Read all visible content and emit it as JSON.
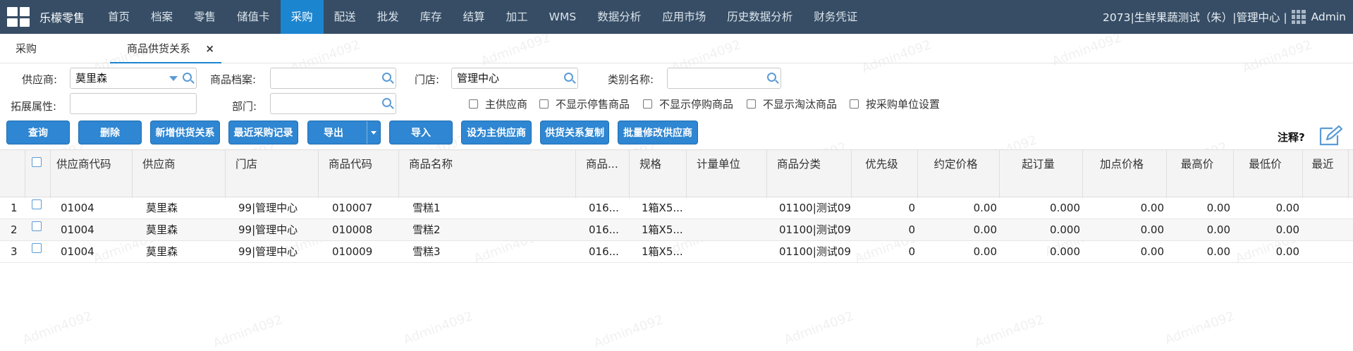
{
  "nav": {
    "brand": "乐檬零售",
    "items": [
      "首页",
      "档案",
      "零售",
      "储值卡",
      "采购",
      "配送",
      "批发",
      "库存",
      "结算",
      "加工",
      "WMS",
      "数据分析",
      "应用市场",
      "历史数据分析",
      "财务凭证"
    ],
    "active_index": 4,
    "org": "2073|生鲜果蔬测试（朱）|管理中心 |",
    "user": "Admin"
  },
  "tabs": {
    "parent": "采购",
    "current": "商品供货关系",
    "close": "×"
  },
  "filters": {
    "supplier_label": "供应商:",
    "supplier_value": "莫里森",
    "item_label": "商品档案:",
    "item_value": "",
    "store_label": "门店:",
    "store_value": "管理中心",
    "category_label": "类别名称:",
    "category_value": "",
    "ext_label": "拓展属性:",
    "ext_value": "",
    "dept_label": "部门:",
    "dept_value": ""
  },
  "checkboxes": [
    "主供应商",
    "不显示停售商品",
    "不显示停购商品",
    "不显示淘汰商品",
    "按采购单位设置"
  ],
  "buttons": {
    "query": "查询",
    "delete": "删除",
    "add": "新增供货关系",
    "recent": "最近采购记录",
    "export": "导出",
    "import": "导入",
    "set_main": "设为主供应商",
    "copy": "供货关系复制",
    "batch": "批量修改供应商"
  },
  "note_label": "注释?",
  "watermark": "Admin4092",
  "table": {
    "headers": [
      "供应商代码",
      "供应商",
      "门店",
      "商品代码",
      "商品名称",
      "商品...",
      "规格",
      "计量单位",
      "商品分类",
      "优先级",
      "约定价格",
      "起订量",
      "加点价格",
      "最高价",
      "最低价",
      "最近"
    ],
    "rows": [
      {
        "idx": "1",
        "supplier_code": "01004",
        "supplier": "莫里森",
        "store": "99|管理中心",
        "item_code": "010007",
        "item_name": "雪糕1",
        "item_short": "016...",
        "spec": "1箱X5...",
        "unit": "",
        "category": "01100|测试09",
        "priority": "0",
        "price": "0.00",
        "moq": "0.000",
        "markup": "0.00",
        "max": "0.00",
        "min": "0.00"
      },
      {
        "idx": "2",
        "supplier_code": "01004",
        "supplier": "莫里森",
        "store": "99|管理中心",
        "item_code": "010008",
        "item_name": "雪糕2",
        "item_short": "016...",
        "spec": "1箱X5...",
        "unit": "",
        "category": "01100|测试09",
        "priority": "0",
        "price": "0.00",
        "moq": "0.000",
        "markup": "0.00",
        "max": "0.00",
        "min": "0.00"
      },
      {
        "idx": "3",
        "supplier_code": "01004",
        "supplier": "莫里森",
        "store": "99|管理中心",
        "item_code": "010009",
        "item_name": "雪糕3",
        "item_short": "016...",
        "spec": "1箱X5...",
        "unit": "",
        "category": "01100|测试09",
        "priority": "0",
        "price": "0.00",
        "moq": "0.000",
        "markup": "0.00",
        "max": "0.00",
        "min": "0.00"
      }
    ]
  },
  "colors": {
    "nav_bg": "#364d65",
    "accent": "#1c85d0",
    "button": "#2f86d2"
  }
}
